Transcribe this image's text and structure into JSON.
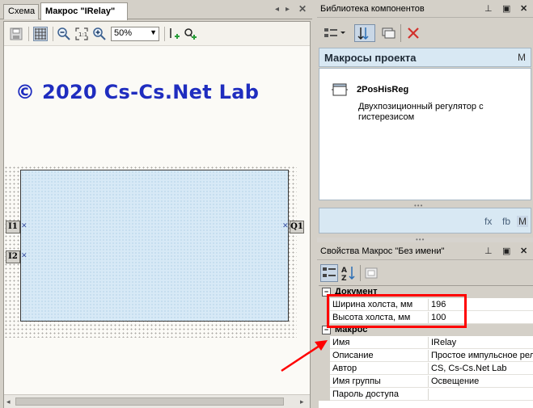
{
  "tabs": [
    {
      "label": "Схема"
    },
    {
      "label": "Макрос \"IRelay\""
    }
  ],
  "toolbar": {
    "zoom_value": "50%"
  },
  "canvas": {
    "watermark": "© 2020 Cs-Cs.Net Lab",
    "pins": {
      "in1": "I1",
      "in2": "I2",
      "out1": "Q1"
    }
  },
  "library": {
    "title": "Библиотека компонентов",
    "section": "Макросы проекта",
    "section_badge": "M",
    "items": [
      {
        "name": "2PosHisReg",
        "description": "Двухпозиционный регулятор с гистерезисом"
      }
    ],
    "footer_tabs": [
      "fx",
      "fb",
      "M"
    ]
  },
  "properties": {
    "title": "Свойства Макрос \"Без имени\"",
    "categories": [
      {
        "name": "Документ",
        "rows": [
          {
            "key": "Ширина холста, мм",
            "value": "196"
          },
          {
            "key": "Высота холста, мм",
            "value": "100"
          }
        ]
      },
      {
        "name": "Макрос",
        "rows": [
          {
            "key": "Имя",
            "value": "IRelay"
          },
          {
            "key": "Описание",
            "value": "Простое импульсное реле"
          },
          {
            "key": "Автор",
            "value": "CS, Cs-Cs.Net Lab"
          },
          {
            "key": "Имя группы",
            "value": "Освещение"
          },
          {
            "key": "Пароль доступа",
            "value": ""
          }
        ]
      }
    ]
  },
  "colors": {
    "watermark": "#1f2dbf",
    "annotation": "#ff0000",
    "macro_fill": "#d7e9f6"
  }
}
